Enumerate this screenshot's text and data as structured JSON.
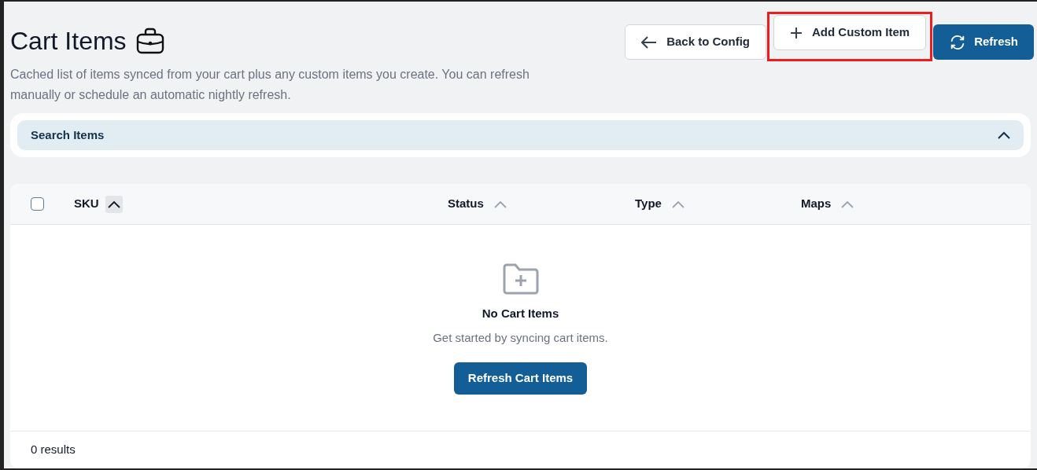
{
  "page": {
    "title": "Cart Items",
    "description": "Cached list of items synced from your cart plus any custom items you create. You can refresh manually or schedule an automatic nightly refresh."
  },
  "actions": [
    {
      "kind": "back",
      "label": "Back to Config",
      "highlighted": false
    },
    {
      "kind": "add",
      "label": "Add Custom Item",
      "highlighted": true
    },
    {
      "kind": "refresh",
      "label": "Refresh",
      "highlighted": false
    }
  ],
  "search_panel": {
    "label": "Search Items",
    "expanded": true
  },
  "table": {
    "select_all_checked": false,
    "columns": [
      {
        "label": "SKU",
        "active": true
      },
      {
        "label": "Status",
        "active": false
      },
      {
        "label": "Type",
        "active": false
      },
      {
        "label": "Maps",
        "active": false
      }
    ],
    "empty_state": {
      "title": "No Cart Items",
      "message": "Get started by syncing cart items.",
      "button": "Refresh Cart Items"
    },
    "footer": "0 results"
  }
}
